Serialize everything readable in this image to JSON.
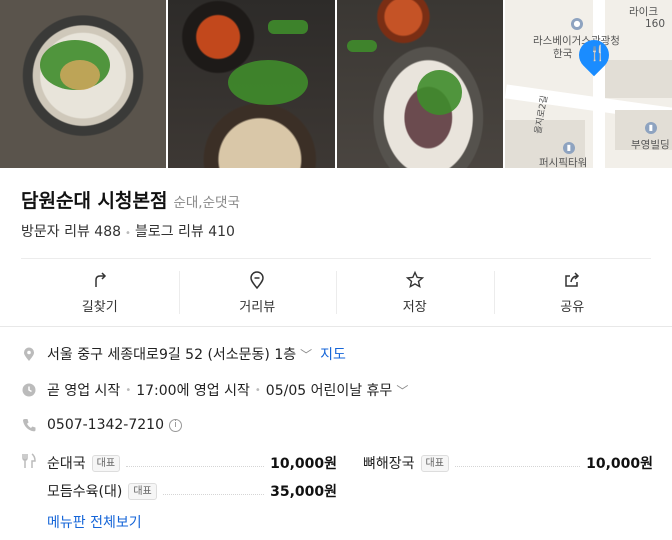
{
  "photos": [
    {
      "name": "photo-soup-bowl"
    },
    {
      "name": "photo-side-dishes"
    },
    {
      "name": "photo-sundae-plate"
    },
    {
      "name": "photo-map"
    }
  ],
  "map": {
    "labels": [
      "라이크",
      "160",
      "라스베이거스관광청",
      "한국",
      "을지로2길",
      "부영빌딩",
      "퍼시픽타워"
    ]
  },
  "place": {
    "name": "담원순대 시청본점",
    "category": "순대,순댓국",
    "visitor_reviews": "방문자 리뷰 488",
    "blog_reviews": "블로그 리뷰 410"
  },
  "actions": [
    {
      "label": "길찾기",
      "icon": "directions-icon"
    },
    {
      "label": "거리뷰",
      "icon": "streetview-icon"
    },
    {
      "label": "저장",
      "icon": "star-icon"
    },
    {
      "label": "공유",
      "icon": "share-icon"
    }
  ],
  "info": {
    "address": "서울 중구 세종대로9길 52 (서소문동) 1층",
    "map_link": "지도",
    "status": "곧 영업 시작",
    "open_time": "17:00에 영업 시작",
    "holiday": "05/05 어린이날 휴무",
    "phone": "0507-1342-7210"
  },
  "menu": {
    "badge": "대표",
    "items": [
      {
        "name": "순대국",
        "price": "10,000원"
      },
      {
        "name": "뼈해장국",
        "price": "10,000원"
      },
      {
        "name": "모듬수육(대)",
        "price": "35,000원"
      }
    ],
    "view_all": "메뉴판 전체보기"
  },
  "colors": {
    "link": "#1565d8",
    "pin": "#1a8cff"
  }
}
